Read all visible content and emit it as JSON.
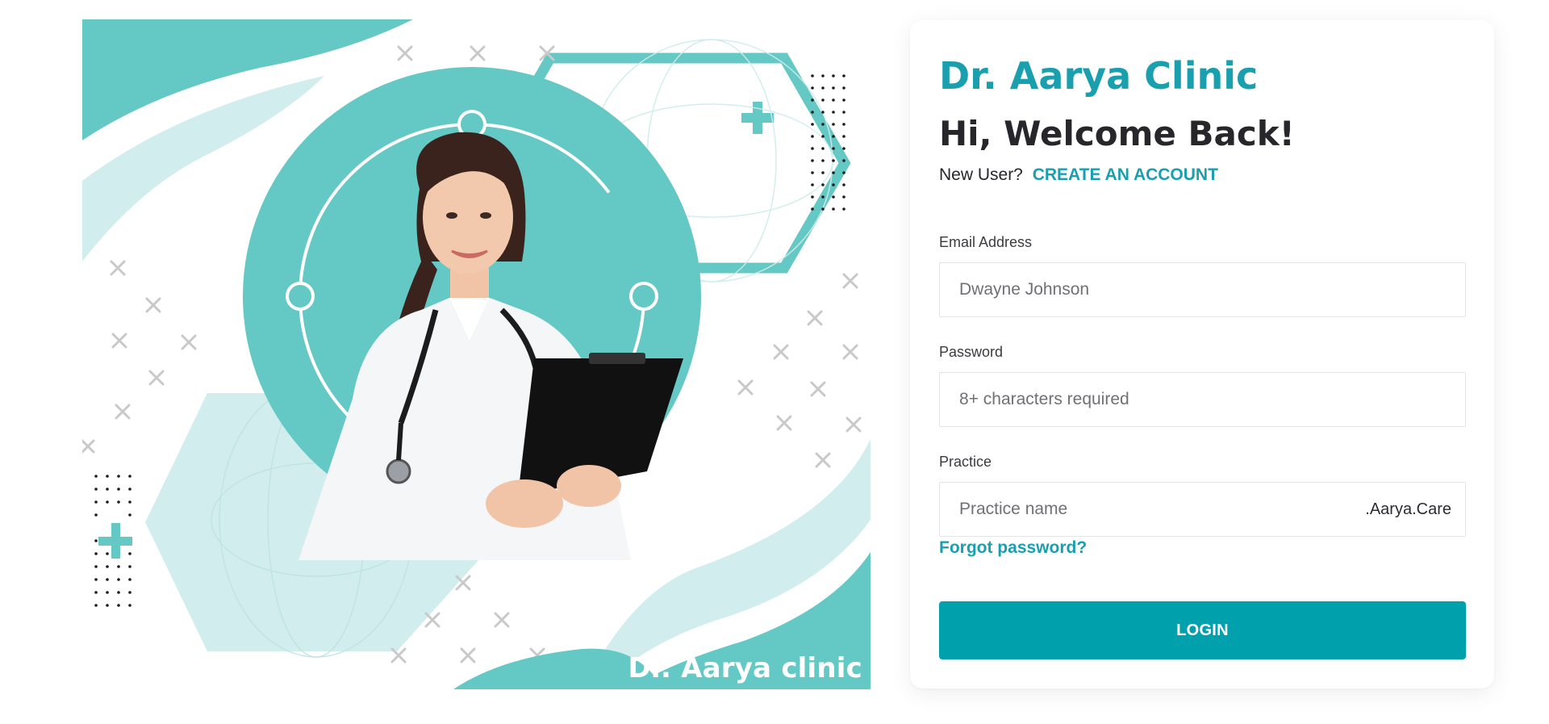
{
  "illustration": {
    "banner_text": "Dr. Aarya clinic",
    "accent_color": "#64c8c4",
    "light_color": "#d1eded"
  },
  "card": {
    "clinic_name": "Dr. Aarya Clinic",
    "welcome": "Hi, Welcome Back!",
    "new_user_text": "New User?",
    "create_account_label": "CREATE AN ACCOUNT",
    "email": {
      "label": "Email Address",
      "placeholder": "Dwayne Johnson"
    },
    "password": {
      "label": "Password",
      "placeholder": "8+ characters required"
    },
    "practice": {
      "label": "Practice",
      "placeholder": "Practice name",
      "suffix": ".Aarya.Care"
    },
    "forgot_label": "Forgot password?",
    "login_label": "LOGIN"
  },
  "colors": {
    "brand": "#1a9fae",
    "button": "#00a0ac",
    "heading": "#26262b"
  }
}
